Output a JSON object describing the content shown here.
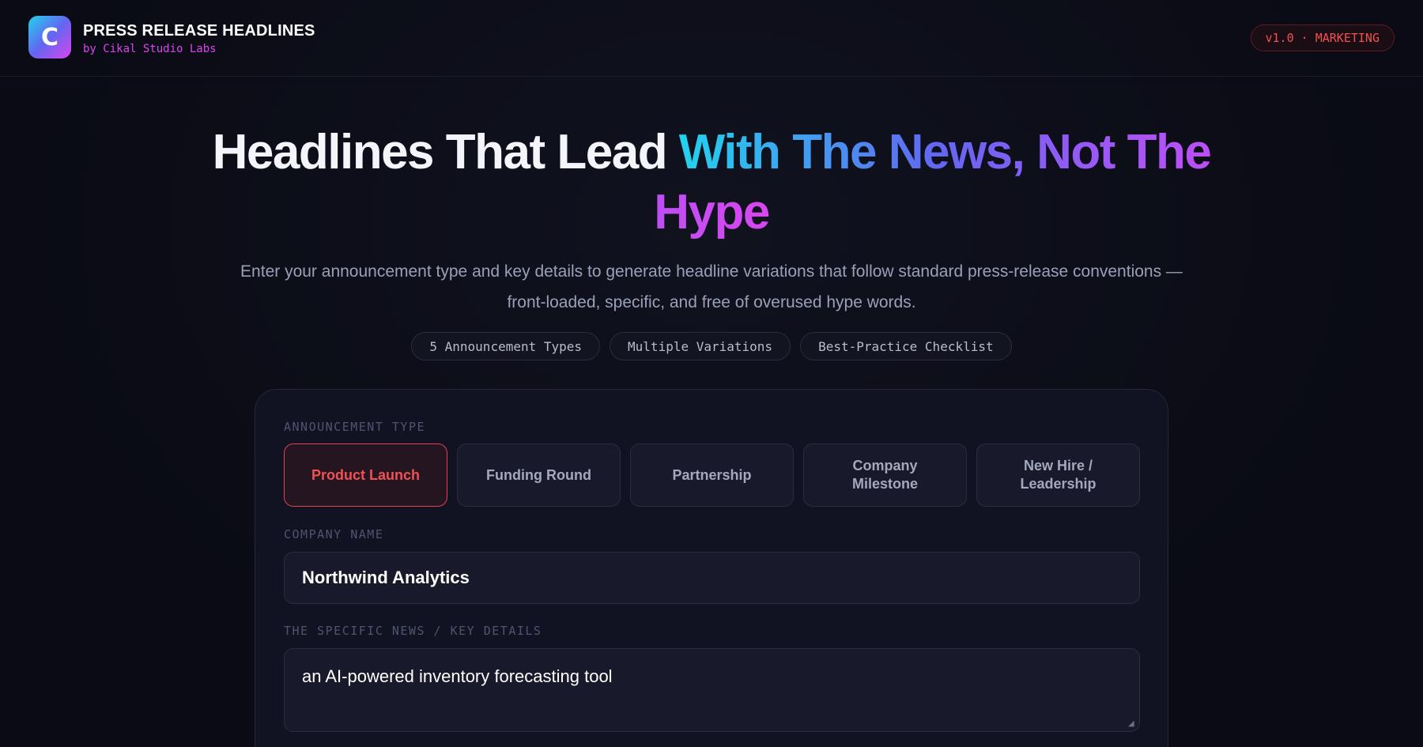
{
  "header": {
    "logo_letter": "C",
    "title": "PRESS RELEASE HEADLINES",
    "subtitle": "by Cikal Studio Labs",
    "version_badge": "v1.0 · MARKETING"
  },
  "hero": {
    "title_plain": "Headlines That Lead ",
    "title_gradient": "With The News, Not The Hype",
    "description": "Enter your announcement type and key details to generate headline variations that follow standard press-release conventions — front-loaded, specific, and free of overused hype words.",
    "features": [
      "5 Announcement Types",
      "Multiple Variations",
      "Best-Practice Checklist"
    ]
  },
  "form": {
    "announcement_type_label": "ANNOUNCEMENT TYPE",
    "types": [
      {
        "label": "Product Launch",
        "selected": true
      },
      {
        "label": "Funding Round",
        "selected": false
      },
      {
        "label": "Partnership",
        "selected": false
      },
      {
        "label": "Company Milestone",
        "selected": false
      },
      {
        "label": "New Hire / Leadership",
        "selected": false
      }
    ],
    "company_name_label": "COMPANY NAME",
    "company_name_value": "Northwind Analytics",
    "details_label": "THE SPECIFIC NEWS / KEY DETAILS",
    "details_value": "an AI-powered inventory forecasting tool"
  },
  "colors": {
    "background": "#0a0b14",
    "accent_red": "#f05252",
    "accent_magenta": "#d946ef",
    "accent_cyan": "#22d3ee",
    "accent_indigo": "#6366f1"
  }
}
